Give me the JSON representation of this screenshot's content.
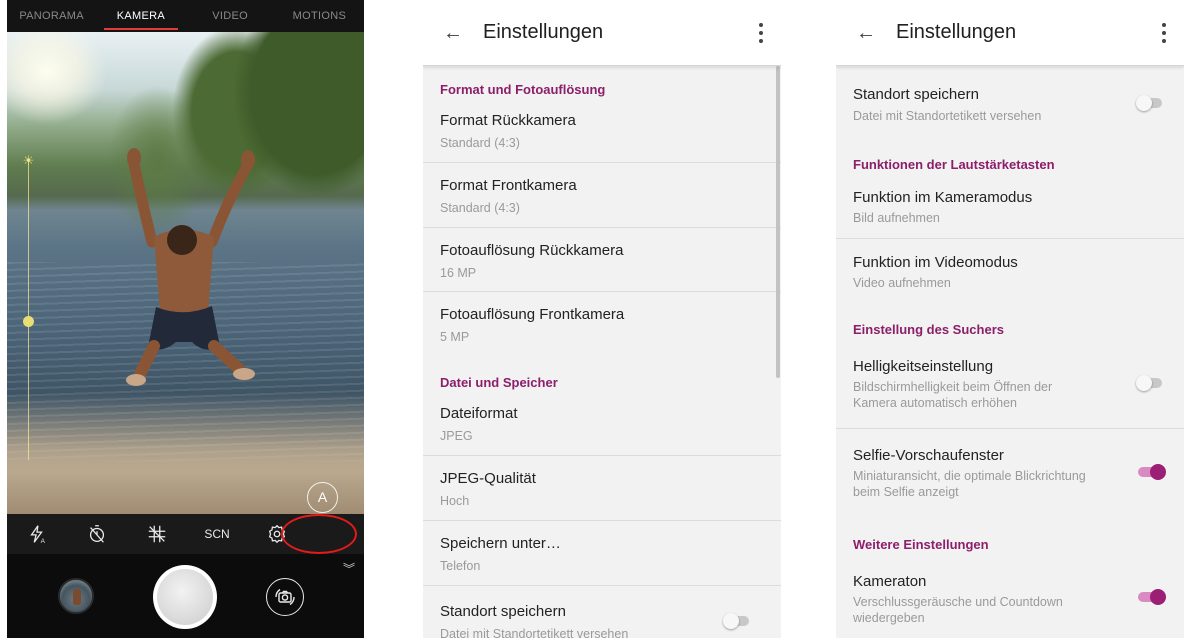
{
  "camera": {
    "modes": [
      "PANORAMA",
      "KAMERA",
      "VIDEO",
      "MOTIONS"
    ],
    "active_mode": "KAMERA",
    "auto_label": "A",
    "tools": {
      "flash_icon": "flash-auto-icon",
      "timer_icon": "timer-off-icon",
      "grid_icon": "grid-off-icon",
      "scene_label": "SCN",
      "settings_icon": "gear-icon"
    },
    "highlight_color": "#e41b1b"
  },
  "settings_left": {
    "title": "Einstellungen",
    "sections": [
      {
        "label": "Format und Fotoauflösung"
      },
      {
        "label": "Datei und Speicher"
      }
    ],
    "items": [
      {
        "title": "Format Rückkamera",
        "subtitle": "Standard (4:3)"
      },
      {
        "title": "Format Frontkamera",
        "subtitle": "Standard (4:3)"
      },
      {
        "title": "Fotoauflösung Rückkamera",
        "subtitle": "16 MP"
      },
      {
        "title": "Fotoauflösung Frontkamera",
        "subtitle": "5 MP"
      },
      {
        "title": "Dateiformat",
        "subtitle": "JPEG"
      },
      {
        "title": "JPEG-Qualität",
        "subtitle": "Hoch"
      },
      {
        "title": "Speichern unter…",
        "subtitle": "Telefon"
      },
      {
        "title": "Standort speichern",
        "subtitle": "Datei mit Standortetikett versehen",
        "enabled": false
      }
    ]
  },
  "settings_right": {
    "title": "Einstellungen",
    "sections": [
      {
        "label": "Funktionen der Lautstärketasten"
      },
      {
        "label": "Einstellung des Suchers"
      },
      {
        "label": "Weitere Einstellungen"
      }
    ],
    "items": [
      {
        "title": "Standort speichern",
        "subtitle": "Datei mit Standortetikett versehen",
        "enabled": false
      },
      {
        "title": "Funktion im Kameramodus",
        "subtitle": "Bild aufnehmen"
      },
      {
        "title": "Funktion im Videomodus",
        "subtitle": "Video aufnehmen"
      },
      {
        "title": "Helligkeitseinstellung",
        "subtitle_1": "Bildschirmhelligkeit beim Öffnen der",
        "subtitle_2": "Kamera automatisch erhöhen",
        "enabled": false
      },
      {
        "title": "Selfie-Vorschaufenster",
        "subtitle_1": "Miniaturansicht, die optimale Blickrichtung",
        "subtitle_2": "beim Selfie anzeigt",
        "enabled": true
      },
      {
        "title": "Kameraton",
        "subtitle_1": "Verschlussgeräusche und Countdown",
        "subtitle_2": "wiedergeben",
        "enabled": true
      }
    ]
  },
  "colors": {
    "accent": "#8c1e6a",
    "toggle_on": "#9c1f76"
  }
}
